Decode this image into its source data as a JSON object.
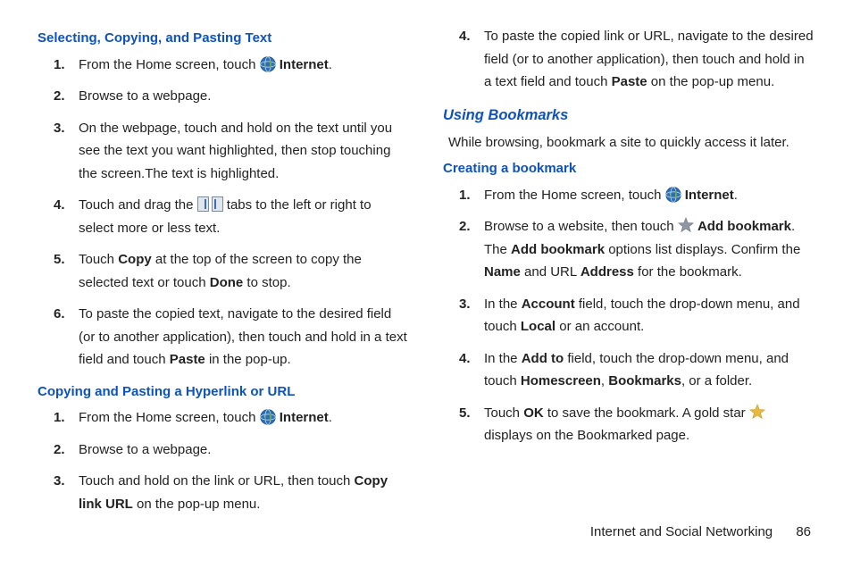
{
  "left": {
    "h1": "Selecting, Copying, and Pasting Text",
    "steps1": [
      {
        "pre": "From the Home screen, touch ",
        "icon": "globe",
        "bold_after": "Internet",
        "post": "."
      },
      {
        "pre": "Browse to a webpage."
      },
      {
        "pre": "On the webpage, touch and hold on the text until you see the text you want highlighted, then stop touching the screen.",
        "extra": "The text is highlighted."
      },
      {
        "pre": "Touch and drag the ",
        "icon": "tabs",
        "post": " tabs to the left or right to select more or less text."
      },
      {
        "pre": "Touch ",
        "bold1": "Copy",
        "mid": " at the top of the screen to copy the selected text or touch ",
        "bold2": "Done",
        "post": " to stop."
      },
      {
        "pre": "To paste the copied text, navigate to the desired field (or to another application), then touch and hold in a text field and touch ",
        "bold1": "Paste",
        "post": " in the pop-up."
      }
    ],
    "h2": "Copying and Pasting a Hyperlink or URL",
    "steps2": [
      {
        "pre": "From the Home screen, touch ",
        "icon": "globe",
        "bold_after": "Internet",
        "post": "."
      },
      {
        "pre": "Browse to a webpage."
      },
      {
        "pre": "Touch and hold on the link or URL, then touch ",
        "bold1": "Copy link URL",
        "post": " on the pop-up menu."
      }
    ]
  },
  "right": {
    "steps2_cont": [
      {
        "num": "4.",
        "pre": "To paste the copied link or URL, navigate to the desired field (or to another application), then touch and hold in a text field and touch ",
        "bold1": "Paste",
        "post": " on the pop-up menu."
      }
    ],
    "h3": "Using Bookmarks",
    "intro": "While browsing, bookmark a site to quickly access it later.",
    "h4": "Creating a bookmark",
    "steps4": [
      {
        "pre": "From the Home screen, touch ",
        "icon": "globe",
        "bold_after": "Internet",
        "post": "."
      },
      {
        "pre": "Browse to a website, then touch ",
        "icon": "star-gray",
        "bold_after": "Add bookmark",
        "post": ".",
        "extra_html": true,
        "extra_pre": "The ",
        "extra_b1": "Add bookmark",
        "extra_mid1": " options list displays. Confirm the ",
        "extra_b2": "Name",
        "extra_mid2": " and URL ",
        "extra_b3": "Address",
        "extra_post": " for the bookmark."
      },
      {
        "pre": "In the ",
        "bold1": "Account",
        "mid": " field, touch the drop-down menu, and touch ",
        "bold2": "Local",
        "post": " or an account."
      },
      {
        "pre": "In the ",
        "bold1": "Add to",
        "mid": " field, touch the drop-down menu, and touch ",
        "bold2": "Homescreen",
        "mid2": ", ",
        "bold3": "Bookmarks",
        "post": ", or a folder."
      },
      {
        "pre": "Touch ",
        "bold1": "OK",
        "post": " to save the bookmark.",
        "extra_pre": "A gold star ",
        "extra_icon": "star-gold",
        "extra_post": " displays on the Bookmarked page."
      }
    ]
  },
  "footer": {
    "section": "Internet and Social Networking",
    "page": "86"
  }
}
